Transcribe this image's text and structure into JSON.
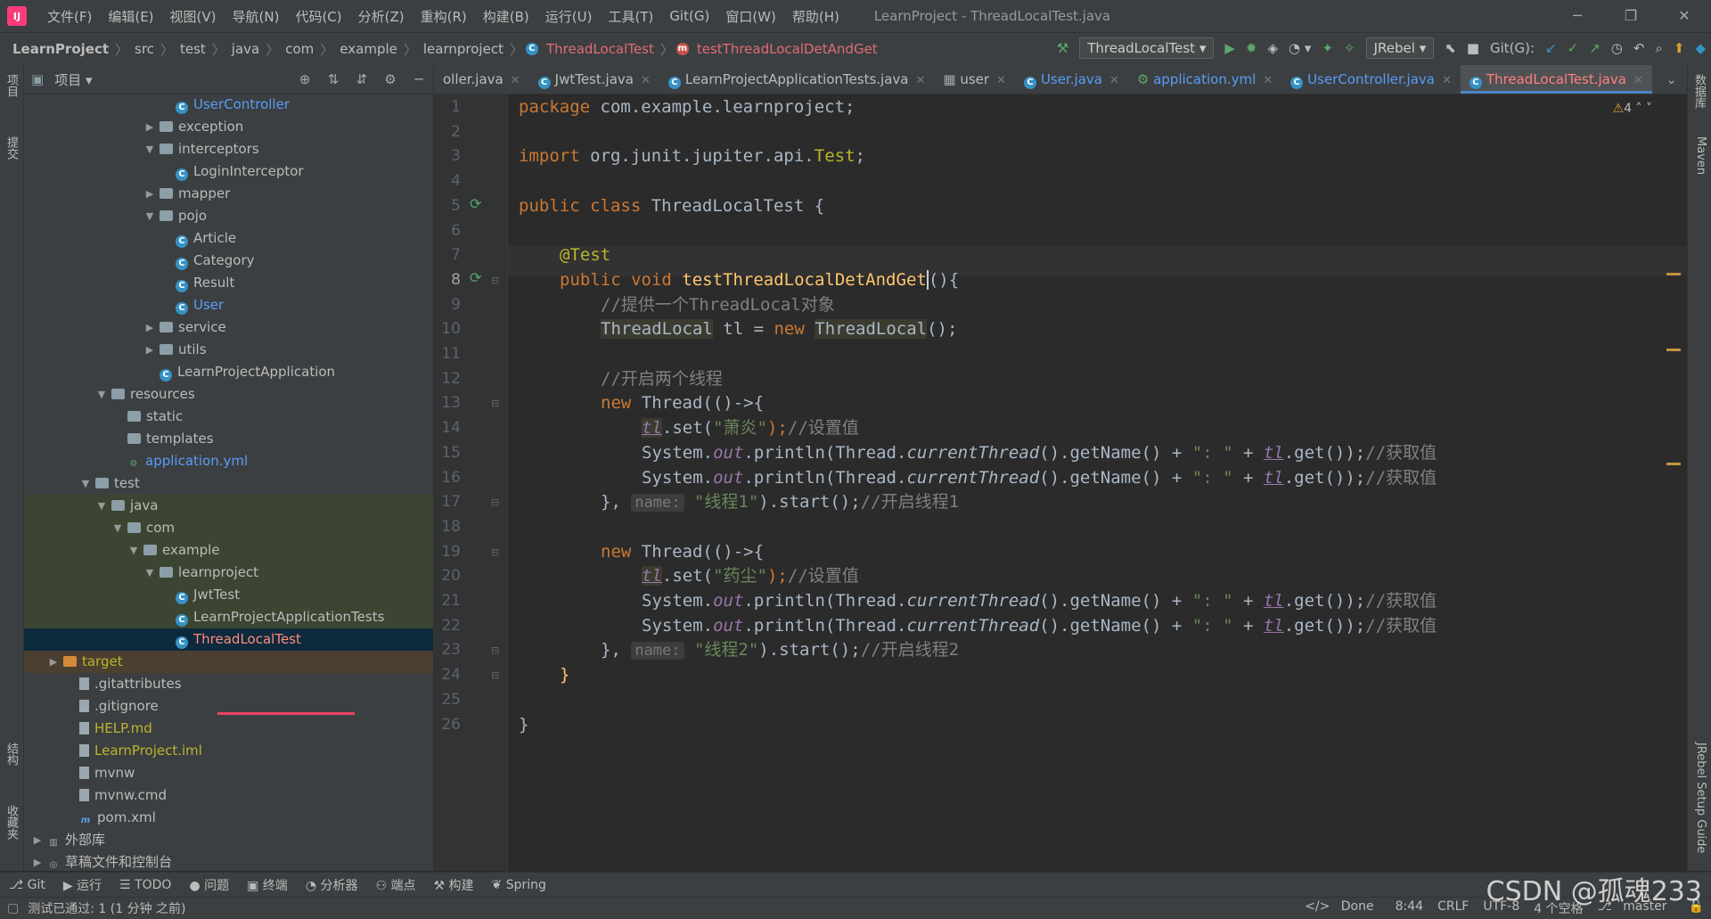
{
  "menu": [
    "文件(F)",
    "编辑(E)",
    "视图(V)",
    "导航(N)",
    "代码(C)",
    "分析(Z)",
    "重构(R)",
    "构建(B)",
    "运行(U)",
    "工具(T)",
    "Git(G)",
    "窗口(W)",
    "帮助(H)"
  ],
  "window_title": "LearnProject - ThreadLocalTest.java",
  "breadcrumbs": [
    "LearnProject",
    "src",
    "test",
    "java",
    "com",
    "example",
    "learnproject",
    "ThreadLocalTest",
    "testThreadLocalDetAndGet"
  ],
  "toolbar": {
    "run_config": "ThreadLocalTest",
    "jrebel": "JRebel",
    "git_label": "Git(G):"
  },
  "project_panel": {
    "title": "项目"
  },
  "tree": [
    {
      "label": "UserController",
      "indent": 8,
      "icon": "class",
      "color": "blue"
    },
    {
      "label": "exception",
      "indent": 7,
      "icon": "folder",
      "arrow": "right"
    },
    {
      "label": "interceptors",
      "indent": 7,
      "icon": "folder",
      "arrow": "down"
    },
    {
      "label": "LoginInterceptor",
      "indent": 8,
      "icon": "class"
    },
    {
      "label": "mapper",
      "indent": 7,
      "icon": "folder",
      "arrow": "right"
    },
    {
      "label": "pojo",
      "indent": 7,
      "icon": "folder",
      "arrow": "down"
    },
    {
      "label": "Article",
      "indent": 8,
      "icon": "class"
    },
    {
      "label": "Category",
      "indent": 8,
      "icon": "class"
    },
    {
      "label": "Result",
      "indent": 8,
      "icon": "class"
    },
    {
      "label": "User",
      "indent": 8,
      "icon": "class",
      "color": "blue"
    },
    {
      "label": "service",
      "indent": 7,
      "icon": "folder",
      "arrow": "right"
    },
    {
      "label": "utils",
      "indent": 7,
      "icon": "folder",
      "arrow": "right"
    },
    {
      "label": "LearnProjectApplication",
      "indent": 7,
      "icon": "class"
    },
    {
      "label": "resources",
      "indent": 4,
      "icon": "folder",
      "arrow": "down"
    },
    {
      "label": "static",
      "indent": 5,
      "icon": "folder"
    },
    {
      "label": "templates",
      "indent": 5,
      "icon": "folder"
    },
    {
      "label": "application.yml",
      "indent": 5,
      "icon": "yml",
      "color": "blue"
    },
    {
      "label": "test",
      "indent": 3,
      "icon": "folder",
      "arrow": "down"
    },
    {
      "label": "java",
      "indent": 4,
      "icon": "folder",
      "arrow": "down",
      "bg": "green"
    },
    {
      "label": "com",
      "indent": 5,
      "icon": "folder",
      "arrow": "down",
      "bg": "green"
    },
    {
      "label": "example",
      "indent": 6,
      "icon": "folder",
      "arrow": "down",
      "bg": "green"
    },
    {
      "label": "learnproject",
      "indent": 7,
      "icon": "folder",
      "arrow": "down",
      "bg": "green"
    },
    {
      "label": "JwtTest",
      "indent": 8,
      "icon": "class",
      "bg": "green"
    },
    {
      "label": "LearnProjectApplicationTests",
      "indent": 8,
      "icon": "class",
      "bg": "green"
    },
    {
      "label": "ThreadLocalTest",
      "indent": 8,
      "icon": "class",
      "bg": "sel",
      "color": "red"
    },
    {
      "label": "target",
      "indent": 1,
      "icon": "folder-orange",
      "arrow": "right",
      "bg": "brown",
      "color": "yellow"
    },
    {
      "label": ".gitattributes",
      "indent": 2,
      "icon": "file"
    },
    {
      "label": ".gitignore",
      "indent": 2,
      "icon": "file"
    },
    {
      "label": "HELP.md",
      "indent": 2,
      "icon": "file",
      "color": "yellow"
    },
    {
      "label": "LearnProject.iml",
      "indent": 2,
      "icon": "file",
      "color": "yellow"
    },
    {
      "label": "mvnw",
      "indent": 2,
      "icon": "file"
    },
    {
      "label": "mvnw.cmd",
      "indent": 2,
      "icon": "file"
    },
    {
      "label": "pom.xml",
      "indent": 2,
      "icon": "maven"
    },
    {
      "label": "外部库",
      "indent": 0,
      "icon": "lib",
      "arrow": "right"
    },
    {
      "label": "草稿文件和控制台",
      "indent": 0,
      "icon": "scratch",
      "arrow": "right"
    }
  ],
  "tabs": [
    {
      "label": "oller.java",
      "icon": "",
      "active": false
    },
    {
      "label": "JwtTest.java",
      "icon": "class",
      "active": false
    },
    {
      "label": "LearnProjectApplicationTests.java",
      "icon": "class",
      "active": false
    },
    {
      "label": "user",
      "icon": "table",
      "active": false
    },
    {
      "label": "User.java",
      "icon": "class",
      "active": false,
      "blue": true
    },
    {
      "label": "application.yml",
      "icon": "yml",
      "active": false,
      "blue": true
    },
    {
      "label": "UserController.java",
      "icon": "class",
      "active": false,
      "blue": true
    },
    {
      "label": "ThreadLocalTest.java",
      "icon": "class",
      "active": true
    }
  ],
  "editor": {
    "warning_count": "4",
    "current_line": 8,
    "lines": [
      "1",
      "2",
      "3",
      "4",
      "5",
      "6",
      "7",
      "8",
      "9",
      "10",
      "11",
      "12",
      "13",
      "14",
      "15",
      "16",
      "17",
      "18",
      "19",
      "20",
      "21",
      "22",
      "23",
      "24",
      "25",
      "26"
    ],
    "code": {
      "l1": {
        "kw": "package ",
        "rest": "com.example.learnproject;"
      },
      "l3": {
        "kw": "import ",
        "rest": "org.junit.jupiter.api.",
        "ann": "Test",
        "end": ";"
      },
      "l5": {
        "kw": "public class ",
        "rest": "ThreadLocalTest {"
      },
      "l7": {
        "ann": "@Test"
      },
      "l8": {
        "kw": "public void ",
        "fn": "testThreadLocalDetAndGet",
        "rest": "(){"
      },
      "l9": {
        "cmt": "//提供一个ThreadLocal对象"
      },
      "l10": {
        "t1": "ThreadLocal",
        "t2": " tl = ",
        "kw": "new ",
        "t3": "ThreadLocal",
        "t4": "();"
      },
      "l12": {
        "cmt": "//开启两个线程"
      },
      "l13": {
        "kw": "new ",
        "rest": "Thread(()->{"
      },
      "l14": {
        "tl": "tl",
        "m": ".set(",
        "str": "\"萧炎\"",
        "end": ");",
        "cmt": "//设置值"
      },
      "l15": {
        "a": "System.",
        "fld": "out",
        "b": ".println(Thread.",
        "it": "currentThread",
        "c": "().getName() + ",
        "str": "\": \"",
        "d": " + ",
        "tl": "tl",
        "e": ".get());",
        "cmt": "//获取值"
      },
      "l16": {
        "a": "System.",
        "fld": "out",
        "b": ".println(Thread.",
        "it": "currentThread",
        "c": "().getName() + ",
        "str": "\": \"",
        "d": " + ",
        "tl": "tl",
        "e": ".get());",
        "cmt": "//获取值"
      },
      "l17": {
        "a": "}, ",
        "hint": "name:",
        "str": "\"线程1\"",
        "b": ").start();",
        "cmt": "//开启线程1"
      },
      "l19": {
        "kw": "new ",
        "rest": "Thread(()->{"
      },
      "l20": {
        "tl": "tl",
        "m": ".set(",
        "str": "\"药尘\"",
        "end": ");",
        "cmt": "//设置值"
      },
      "l21": {
        "a": "System.",
        "fld": "out",
        "b": ".println(Thread.",
        "it": "currentThread",
        "c": "().getName() + ",
        "str": "\": \"",
        "d": " + ",
        "tl": "tl",
        "e": ".get());",
        "cmt": "//获取值"
      },
      "l22": {
        "a": "System.",
        "fld": "out",
        "b": ".println(Thread.",
        "it": "currentThread",
        "c": "().getName() + ",
        "str": "\": \"",
        "d": " + ",
        "tl": "tl",
        "e": ".get());",
        "cmt": "//获取值"
      },
      "l23": {
        "a": "}, ",
        "hint": "name:",
        "str": "\"线程2\"",
        "b": ").start();",
        "cmt": "//开启线程2"
      },
      "l24": {
        "rest": "}"
      },
      "l26": {
        "rest": "}"
      }
    }
  },
  "bottom_tools": [
    "Git",
    "运行",
    "TODO",
    "问题",
    "终端",
    "分析器",
    "端点",
    "构建",
    "Spring"
  ],
  "status": {
    "message": "测试已通过: 1 (1 分钟 之前)",
    "done": "Done",
    "position": "8:44",
    "line_sep": "CRLF",
    "encoding": "UTF-8",
    "indent": "4 个空格",
    "branch": "master"
  },
  "left_strip": [
    "项目",
    "提交",
    "结构",
    "收藏夹"
  ],
  "right_strip": [
    "数据库",
    "Maven",
    "JRebel Setup Guide"
  ],
  "watermark": "CSDN @孤魂233",
  "colors": {
    "keyword": "#cc7832",
    "string": "#6a8759",
    "comment": "#808080",
    "annotation": "#bbb529",
    "function": "#ffc66d",
    "field": "#9876aa",
    "active_tab": "#ff7f7f"
  }
}
